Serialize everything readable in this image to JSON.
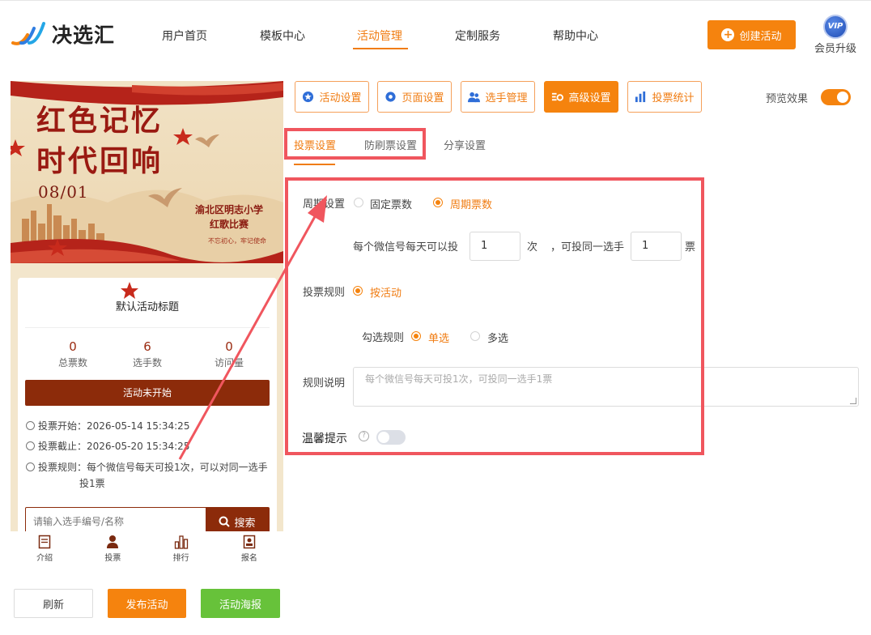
{
  "brand": {
    "name": "决选汇"
  },
  "nav": {
    "items": [
      "用户首页",
      "模板中心",
      "活动管理",
      "定制服务",
      "帮助中心"
    ],
    "active_index": 2
  },
  "header": {
    "create_label": "创建活动",
    "vip_badge": "VIP",
    "vip_label": "会员升级"
  },
  "preview": {
    "banner_line1": "红色记忆",
    "banner_line2": "时代回响",
    "banner_date": "08/01",
    "banner_school": "渝北区明志小学",
    "banner_event": "红歌比赛",
    "banner_slogan": "不忘初心，牢记使命",
    "activity_title": "默认活动标题",
    "stats": [
      {
        "value": "0",
        "label": "总票数"
      },
      {
        "value": "6",
        "label": "选手数"
      },
      {
        "value": "0",
        "label": "访问量"
      }
    ],
    "status": "活动未开始",
    "vote_start": "投票开始：2026-05-14 15:34:25",
    "vote_end": "投票截止：2026-05-20 15:34:25",
    "vote_rule_line1": "投票规则：每个微信号每天可投1次，可以对同一选手",
    "vote_rule_line2": "投1票",
    "search_placeholder": "请输入选手编号/名称",
    "search_button": "搜索",
    "bottom_nav": [
      "介绍",
      "投票",
      "排行",
      "报名"
    ]
  },
  "actions": {
    "refresh": "刷新",
    "publish": "发布活动",
    "poster": "活动海报"
  },
  "config_tabs": [
    "活动设置",
    "页面设置",
    "选手管理",
    "高级设置",
    "投票统计"
  ],
  "config_active_index": 3,
  "preview_toggle": {
    "label": "预览效果",
    "on": true
  },
  "sub_tabs": [
    "投票设置",
    "防刷票设置",
    "分享设置"
  ],
  "sub_active_index": 0,
  "form": {
    "period_label": "周期设置",
    "period_options": [
      "固定票数",
      "周期票数"
    ],
    "period_selected": 1,
    "daily_prefix": "每个微信号每天可以投",
    "daily_value": "1",
    "daily_unit": "次",
    "same_prefix": "，可投同一选手",
    "same_value": "1",
    "same_unit": "票",
    "rule_label": "投票规则",
    "rule_option": "按活动",
    "check_label": "勾选规则",
    "check_options": [
      "单选",
      "多选"
    ],
    "check_selected": 0,
    "desc_label": "规则说明",
    "desc_placeholder": "每个微信号每天可投1次，可投同一选手1票",
    "tip_label": "温馨提示",
    "tip_help": "?",
    "tip_on": false
  },
  "colors": {
    "accent": "#f5830e",
    "highlight": "#f0565e",
    "theme": "#8c2b0a",
    "success": "#67c23a"
  }
}
